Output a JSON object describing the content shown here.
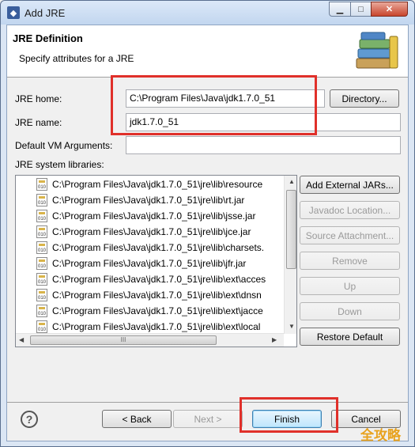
{
  "window": {
    "title": "Add JRE",
    "icon": "eclipse-icon"
  },
  "header": {
    "title": "JRE Definition",
    "description": "Specify attributes for a JRE",
    "icon": "library-books-icon"
  },
  "form": {
    "jre_home_label": "JRE home:",
    "jre_home_value": "C:\\Program Files\\Java\\jdk1.7.0_51",
    "directory_button": "Directory...",
    "jre_name_label": "JRE name:",
    "jre_name_value": "jdk1.7.0_51",
    "vm_args_label": "Default VM Arguments:",
    "vm_args_value": "",
    "libraries_label": "JRE system libraries:"
  },
  "libraries": [
    {
      "path": "C:\\Program Files\\Java\\jdk1.7.0_51\\jre\\lib\\resource"
    },
    {
      "path": "C:\\Program Files\\Java\\jdk1.7.0_51\\jre\\lib\\rt.jar"
    },
    {
      "path": "C:\\Program Files\\Java\\jdk1.7.0_51\\jre\\lib\\jsse.jar"
    },
    {
      "path": "C:\\Program Files\\Java\\jdk1.7.0_51\\jre\\lib\\jce.jar"
    },
    {
      "path": "C:\\Program Files\\Java\\jdk1.7.0_51\\jre\\lib\\charsets."
    },
    {
      "path": "C:\\Program Files\\Java\\jdk1.7.0_51\\jre\\lib\\jfr.jar"
    },
    {
      "path": "C:\\Program Files\\Java\\jdk1.7.0_51\\jre\\lib\\ext\\acces"
    },
    {
      "path": "C:\\Program Files\\Java\\jdk1.7.0_51\\jre\\lib\\ext\\dnsn"
    },
    {
      "path": "C:\\Program Files\\Java\\jdk1.7.0_51\\jre\\lib\\ext\\jacce"
    },
    {
      "path": "C:\\Program Files\\Java\\jdk1.7.0_51\\jre\\lib\\ext\\local"
    }
  ],
  "side_buttons": {
    "add_external_jars": "Add External JARs...",
    "javadoc_location": "Javadoc Location...",
    "source_attachment": "Source Attachment...",
    "remove": "Remove",
    "up": "Up",
    "down": "Down",
    "restore_default": "Restore Default"
  },
  "footer": {
    "help": "?",
    "back": "< Back",
    "next": "Next >",
    "finish": "Finish",
    "cancel": "Cancel"
  },
  "scroll": {
    "hthumb_label": "III"
  },
  "watermark": "全攻略",
  "colors": {
    "highlight_box": "#e0302a",
    "default_button_border": "#3c7fb1"
  }
}
